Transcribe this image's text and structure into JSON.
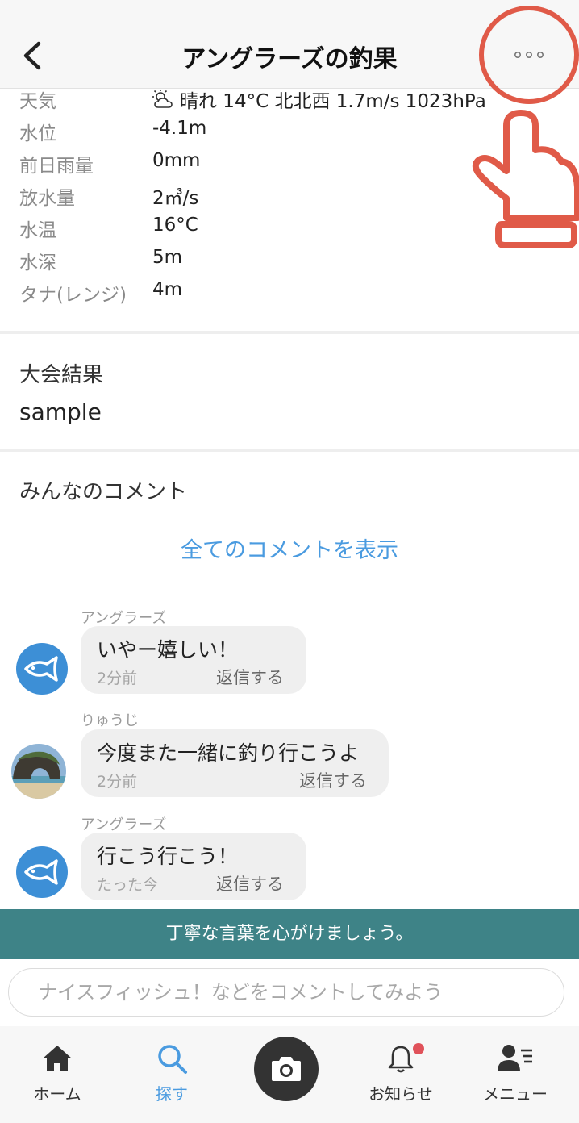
{
  "header": {
    "title": "アングラーズの釣果",
    "more_label": "°°°"
  },
  "info": {
    "rows": [
      {
        "label": "天気",
        "value": "晴れ  14°C  北北西  1.7m/s  1023hPa",
        "icon": "partly-cloudy-icon"
      },
      {
        "label": "水位",
        "value": "-4.1m"
      },
      {
        "label": "前日雨量",
        "value": "0mm"
      },
      {
        "label": "放水量",
        "value": "2㎥/s"
      },
      {
        "label": "水温",
        "value": "16°C"
      },
      {
        "label": "水深",
        "value": "5m"
      },
      {
        "label": "タナ(レンジ)",
        "value": "4m"
      }
    ]
  },
  "tournament": {
    "title": "大会結果",
    "value": "sample"
  },
  "comments": {
    "title": "みんなのコメント",
    "show_all": "全てのコメントを表示",
    "items": [
      {
        "author": "アングラーズ",
        "text": "いやー嬉しい！",
        "time": "2分前",
        "reply": "返信する",
        "avatar": "fish-logo-icon"
      },
      {
        "author": "りゅうじ",
        "text": "今度また一緒に釣り行こうよ",
        "time": "2分前",
        "reply": "返信する",
        "avatar": "user-photo"
      },
      {
        "author": "アングラーズ",
        "text": "行こう行こう！",
        "time": "たった今",
        "reply": "返信する",
        "avatar": "fish-logo-icon"
      }
    ]
  },
  "notice": "丁寧な言葉を心がけましょう。",
  "comment_input": {
    "placeholder": "ナイスフィッシュ！などをコメントしてみよう"
  },
  "nav": {
    "items": [
      {
        "label": "ホーム",
        "icon": "home-icon",
        "active": false
      },
      {
        "label": "探す",
        "icon": "search-icon",
        "active": true
      },
      {
        "label": "",
        "icon": "camera-icon",
        "active": false
      },
      {
        "label": "お知らせ",
        "icon": "bell-icon",
        "active": false,
        "badge": true
      },
      {
        "label": "メニュー",
        "icon": "user-menu-icon",
        "active": false
      }
    ]
  },
  "colors": {
    "accent": "#4a9be0",
    "notice_bg": "#3e8387",
    "annotation": "#e05a48",
    "badge": "#e0525a"
  }
}
